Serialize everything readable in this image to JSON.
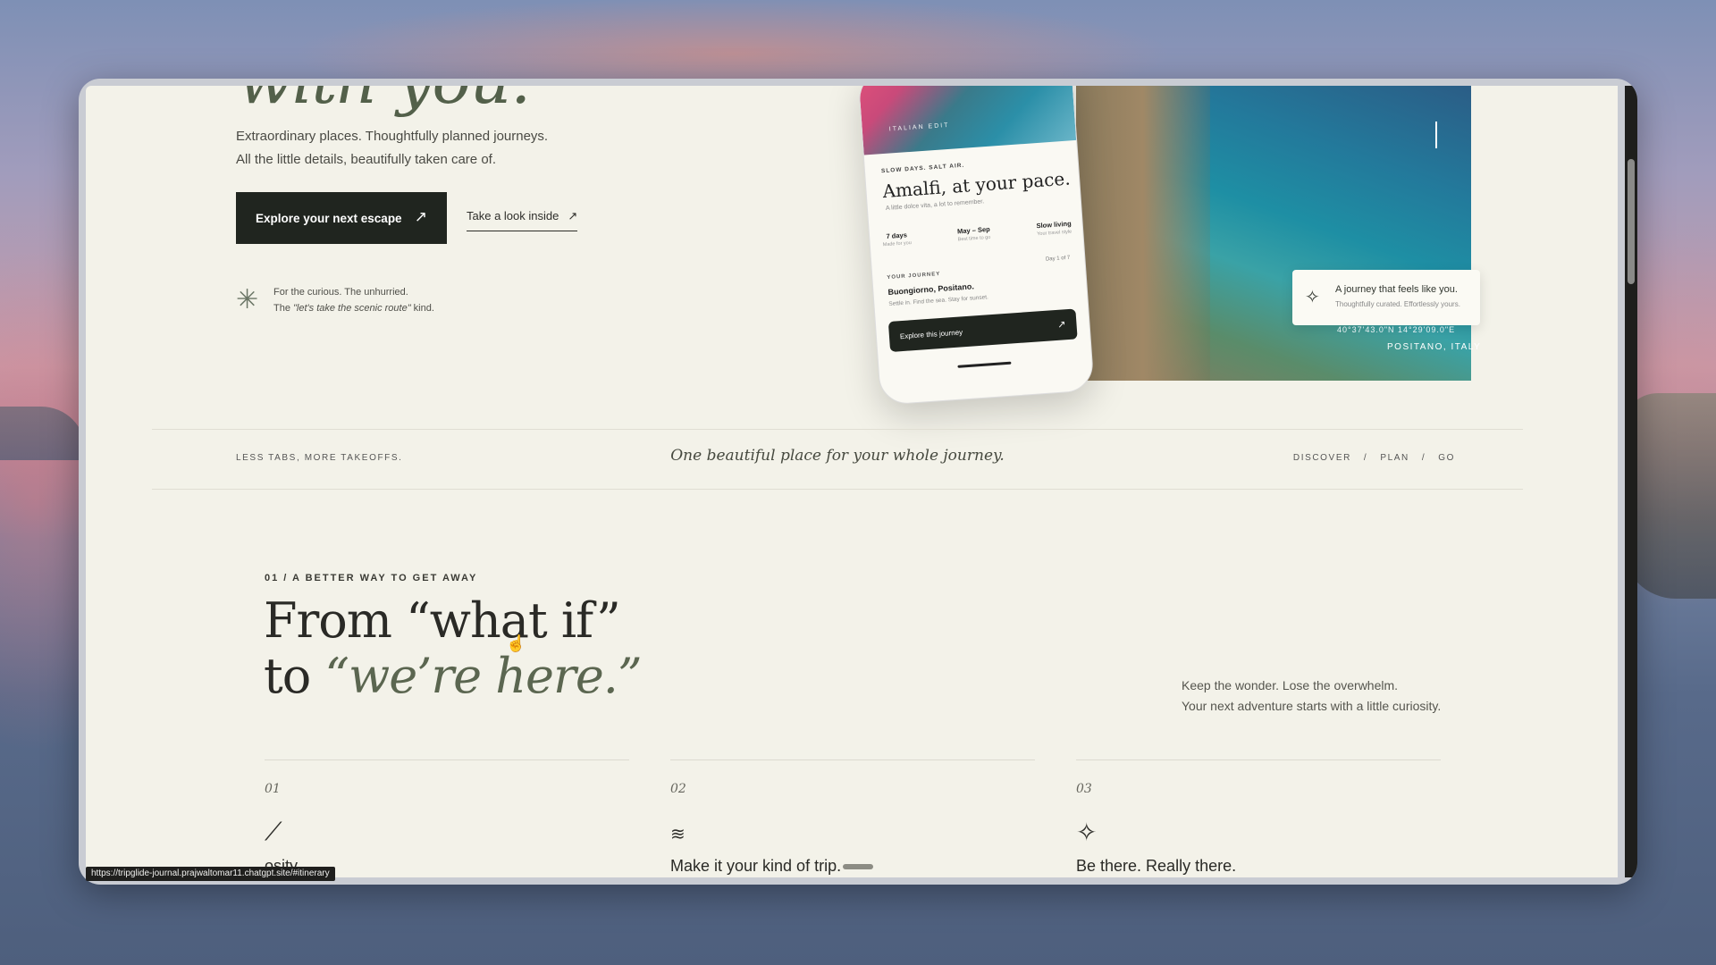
{
  "hero": {
    "title_fragment": "with you.",
    "lead_line1": "Extraordinary places. Thoughtfully planned journeys.",
    "lead_line2": "All the little details, beautifully taken care of.",
    "primary_button": "Explore your next escape",
    "secondary_link": "Take a look inside",
    "arrow_glyph": "↗",
    "tagline_line1": "For the curious. The unhurried.",
    "tagline_line2_pre": "The ",
    "tagline_line2_em": "\"let's take the scenic route\"",
    "tagline_line2_post": " kind."
  },
  "phone": {
    "image_label": "ITALIAN EDIT",
    "eyebrow": "SLOW DAYS. SALT AIR.",
    "title": "Amalfi, at your pace.",
    "subtitle": "A little dolce vita, a lot to remember.",
    "stats": [
      {
        "value": "7 days",
        "label": "Made for you"
      },
      {
        "value": "May – Sep",
        "label": "Best time to go"
      },
      {
        "value": "Slow living",
        "label": "Your travel style"
      }
    ],
    "journey_label": "YOUR JOURNEY",
    "day_label": "Day 1 of 7",
    "journey_title": "Buongiorno, Positano.",
    "journey_sub": "Settle in. Find the sea. Stay for sunset.",
    "button": "Explore this journey"
  },
  "photo_card": {
    "title": "A journey that feels like you.",
    "subtitle": "Thoughtfully curated. Effortlessly yours.",
    "coords": "40°37'43.0\"N 14°29'09.0\"E",
    "place": "POSITANO, ITALY"
  },
  "band": {
    "left": "LESS TABS, MORE TAKEOFFS.",
    "center": "One beautiful place for your whole journey.",
    "nav": [
      "DISCOVER",
      "PLAN",
      "GO"
    ],
    "separator": "/"
  },
  "section": {
    "eyebrow": "01 / A BETTER WAY TO GET AWAY",
    "headline_line1": "From “what if”",
    "headline_line2_pre": "to ",
    "headline_line2_accent": "“we’re here.”",
    "side_line1": "Keep the wonder. Lose the overwhelm.",
    "side_line2": "Your next adventure starts with a little curiosity."
  },
  "features": [
    {
      "num": "01",
      "icon": "arrow-icon",
      "title": "osity."
    },
    {
      "num": "02",
      "icon": "waves-icon",
      "title": "Make it your kind of trip."
    },
    {
      "num": "03",
      "icon": "sparkle-icon",
      "title": "Be there. Really there."
    }
  ],
  "status_bar": {
    "url": "https://tripglide-journal.prajwaltomar11.chatgpt.site/#itinerary"
  }
}
